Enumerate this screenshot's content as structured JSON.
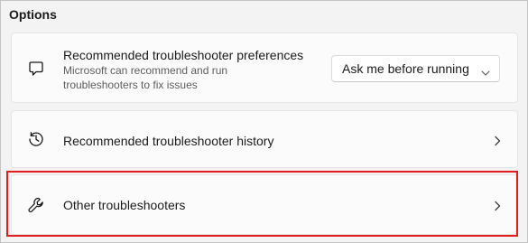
{
  "section": {
    "title": "Options"
  },
  "cards": [
    {
      "icon": "feedback-message-icon",
      "title": "Recommended troubleshooter preferences",
      "description": "Microsoft can recommend and run troubleshooters to fix issues",
      "dropdown": {
        "selected": "Ask me before running"
      }
    },
    {
      "icon": "history-icon",
      "title": "Recommended troubleshooter history"
    },
    {
      "icon": "wrench-icon",
      "title": "Other troubleshooters"
    }
  ],
  "colors": {
    "highlight": "#e21d1d",
    "card_background": "#fbfbfb",
    "page_background": "#f3f3f3"
  }
}
